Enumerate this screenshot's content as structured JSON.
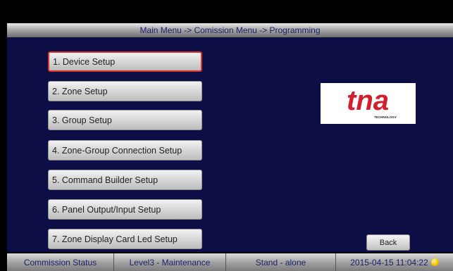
{
  "header": {
    "breadcrumb": "Main Menu -> Comission Menu -> Programming"
  },
  "menu": {
    "items": [
      {
        "label": "1. Device Setup",
        "selected": true
      },
      {
        "label": "2. Zone Setup",
        "selected": false
      },
      {
        "label": "3. Group Setup",
        "selected": false
      },
      {
        "label": "4. Zone-Group Connection Setup",
        "selected": false
      },
      {
        "label": "5. Command Builder Setup",
        "selected": false
      },
      {
        "label": "6. Panel Output/Input Setup",
        "selected": false
      },
      {
        "label": "7. Zone Display Card Led Setup",
        "selected": false
      }
    ]
  },
  "logo": {
    "brand": "tna",
    "tagline": "TECHNOLOGY",
    "color": "#d01f2e"
  },
  "actions": {
    "back_label": "Back"
  },
  "status": {
    "title": "Commission Status",
    "level": "Level3 - Maintenance",
    "mode": "Stand - alone",
    "datetime": "2015-04-15 11:04:22",
    "indicator_color": "#f5c400"
  },
  "colors": {
    "background": "#0e0e46",
    "selected_border": "#d9332a",
    "title_text": "#1d1d6a"
  }
}
